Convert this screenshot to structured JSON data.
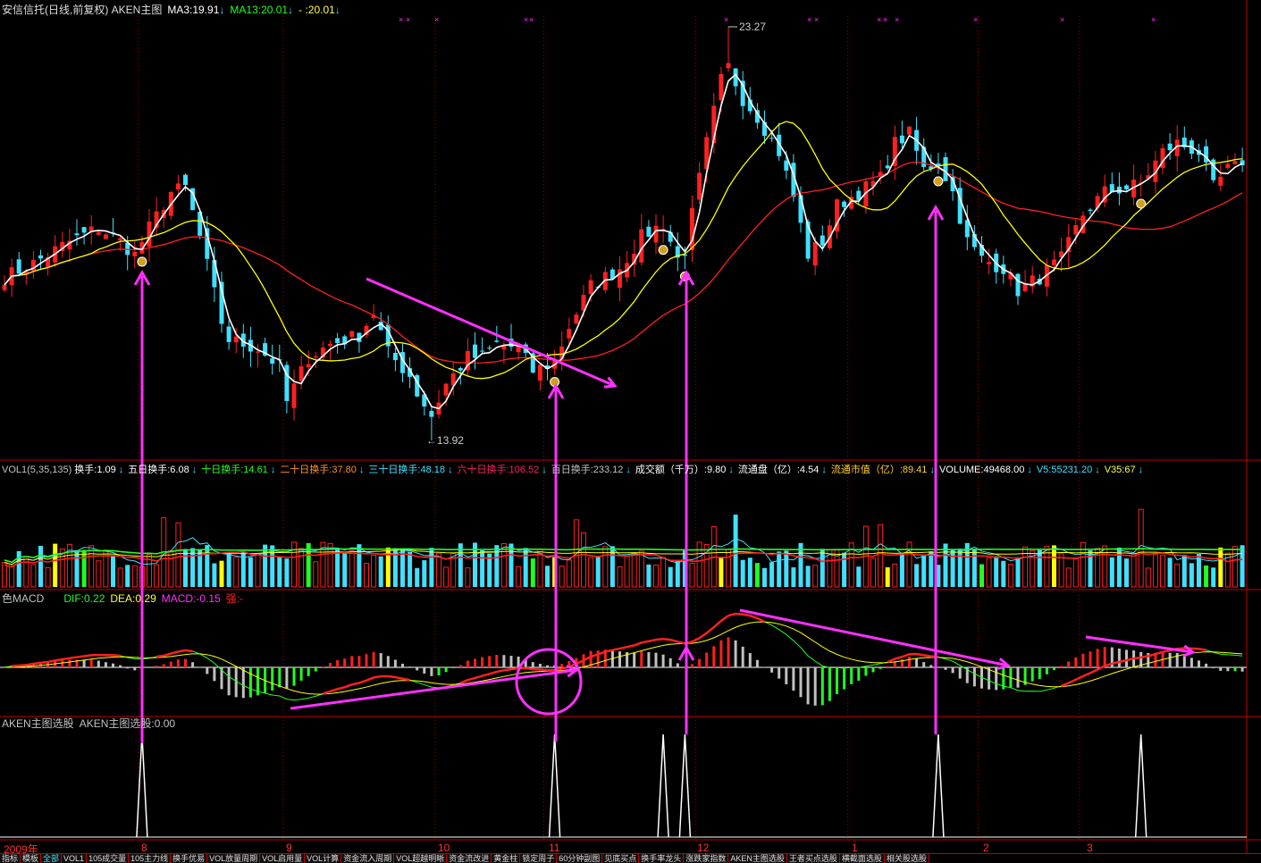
{
  "header": {
    "title": "安信信托(日线,前复权) AKEN主图",
    "ma3": "MA3:19.91",
    "ma13": "MA13:20.01",
    "ma_x": "-  :20.01",
    "arrow": "↓"
  },
  "vol_header": {
    "name": "VOL1(5,35,135)",
    "items": [
      {
        "label": "换手:1.09",
        "color": "#ffffff"
      },
      {
        "label": "五日换手:6.08",
        "color": "#ffffff"
      },
      {
        "label": "十日换手:14.61",
        "color": "#20ff20"
      },
      {
        "label": "二十日换手:37.80",
        "color": "#ff9020"
      },
      {
        "label": "三十日换手:48.18",
        "color": "#40e0ff"
      },
      {
        "label": "六十日换手:106.52",
        "color": "#ff2060"
      },
      {
        "label": "百日换手:233.12",
        "color": "#c0c0c0"
      },
      {
        "label": "成交额（千万）:9.80",
        "color": "#ffffff"
      },
      {
        "label": "流通盘（亿）:4.54",
        "color": "#ffffff"
      },
      {
        "label": "流通市值（亿）:89.41",
        "color": "#ffd030"
      },
      {
        "label": "VOLUME:49468.00",
        "color": "#ffffff"
      },
      {
        "label": "V5:55231.20",
        "color": "#40e0ff"
      },
      {
        "label": "V35:67",
        "color": "#ffff40"
      }
    ]
  },
  "macd_header": {
    "name": "色MACD",
    "dif": "DIF:0.22",
    "dea": "DEA:0.29",
    "macd": "MACD:-0.15",
    "strong": "强:-"
  },
  "aken_header": {
    "name": "AKEN主图选股",
    "value": "AKEN主图选股:0.00"
  },
  "x_axis": {
    "labels": [
      "2009年",
      "8",
      "9",
      "10",
      "11",
      "12",
      "1",
      "2",
      "3"
    ]
  },
  "tabs": [
    "指标",
    "模板",
    "全部",
    "VOL1",
    "105成交量",
    "105主力线",
    "换手优易",
    "VOL放量周期",
    "VOL启用量",
    "VOL计算",
    "资金流入周期",
    "VOL超越明晰",
    "资金流改进",
    "黄金柱",
    "锁定周子",
    "60分钟副图",
    "见底买点",
    "换手率龙头",
    "涨跌家指数",
    "AKEN主图选股",
    "王者买点选股",
    "横截面选股",
    "相关股选股"
  ],
  "chart_data": {
    "type": "candlestick",
    "title": "安信信托(日线,前复权)",
    "close_waypoints": [
      [
        0,
        17.61
      ],
      [
        4,
        17.92
      ],
      [
        9,
        18.42
      ],
      [
        13,
        18.72
      ],
      [
        16,
        18.42
      ],
      [
        18,
        18.12
      ],
      [
        20,
        18.72
      ],
      [
        23,
        19.53
      ],
      [
        25,
        19.63
      ],
      [
        27,
        18.52
      ],
      [
        30,
        16.6
      ],
      [
        31,
        16.2
      ],
      [
        35,
        16.0
      ],
      [
        38,
        15.59
      ],
      [
        39,
        14.79
      ],
      [
        42,
        15.8
      ],
      [
        45,
        16.1
      ],
      [
        49,
        16.3
      ],
      [
        51,
        16.81
      ],
      [
        53,
        15.9
      ],
      [
        56,
        15.39
      ],
      [
        57,
        14.99
      ],
      [
        59,
        14.48
      ],
      [
        61,
        15.19
      ],
      [
        64,
        15.8
      ],
      [
        66,
        15.8
      ],
      [
        68,
        16.1
      ],
      [
        71,
        16.0
      ],
      [
        73,
        15.49
      ],
      [
        76,
        15.69
      ],
      [
        78,
        16.5
      ],
      [
        81,
        17.41
      ],
      [
        85,
        17.82
      ],
      [
        88,
        18.52
      ],
      [
        91,
        18.83
      ],
      [
        93,
        18.02
      ],
      [
        94,
        18.22
      ],
      [
        97,
        20.64
      ],
      [
        99,
        22.06
      ],
      [
        100,
        22.36
      ],
      [
        102,
        21.65
      ],
      [
        104,
        21.25
      ],
      [
        107,
        20.44
      ],
      [
        109,
        19.43
      ],
      [
        111,
        18.12
      ],
      [
        113,
        18.42
      ],
      [
        115,
        19.23
      ],
      [
        118,
        19.53
      ],
      [
        121,
        19.84
      ],
      [
        123,
        20.64
      ],
      [
        125,
        20.85
      ],
      [
        127,
        20.04
      ],
      [
        129,
        20.24
      ],
      [
        131,
        19.53
      ],
      [
        133,
        18.42
      ],
      [
        135,
        18.02
      ],
      [
        138,
        17.82
      ],
      [
        140,
        17.31
      ],
      [
        143,
        17.61
      ],
      [
        146,
        18.02
      ],
      [
        149,
        19.03
      ],
      [
        152,
        19.53
      ],
      [
        155,
        19.63
      ],
      [
        157,
        19.73
      ],
      [
        160,
        20.44
      ],
      [
        162,
        20.64
      ],
      [
        165,
        20.44
      ],
      [
        167,
        19.63
      ],
      [
        169,
        20.04
      ],
      [
        171,
        20.14
      ]
    ],
    "high_label": "23.27",
    "low_label": "←13.92",
    "high": 23.27,
    "low": 13.92,
    "high_day": 100,
    "low_day": 59,
    "signal_days": [
      19,
      76,
      91,
      94,
      129,
      157
    ],
    "ylim": [
      13.92,
      23.27
    ],
    "month_days": [
      19,
      39,
      60,
      75,
      96,
      117,
      135,
      149
    ],
    "ma_periods": [
      3,
      13,
      30
    ],
    "macd_params": [
      12,
      26,
      9
    ]
  },
  "colors": {
    "up": "#ff2020",
    "down": "#40e0ff",
    "ma3": "#ffffff",
    "ma13": "#ffff00",
    "ma30": "#ff2020",
    "annotation": "#ff30ff",
    "grid": "#c00000"
  }
}
